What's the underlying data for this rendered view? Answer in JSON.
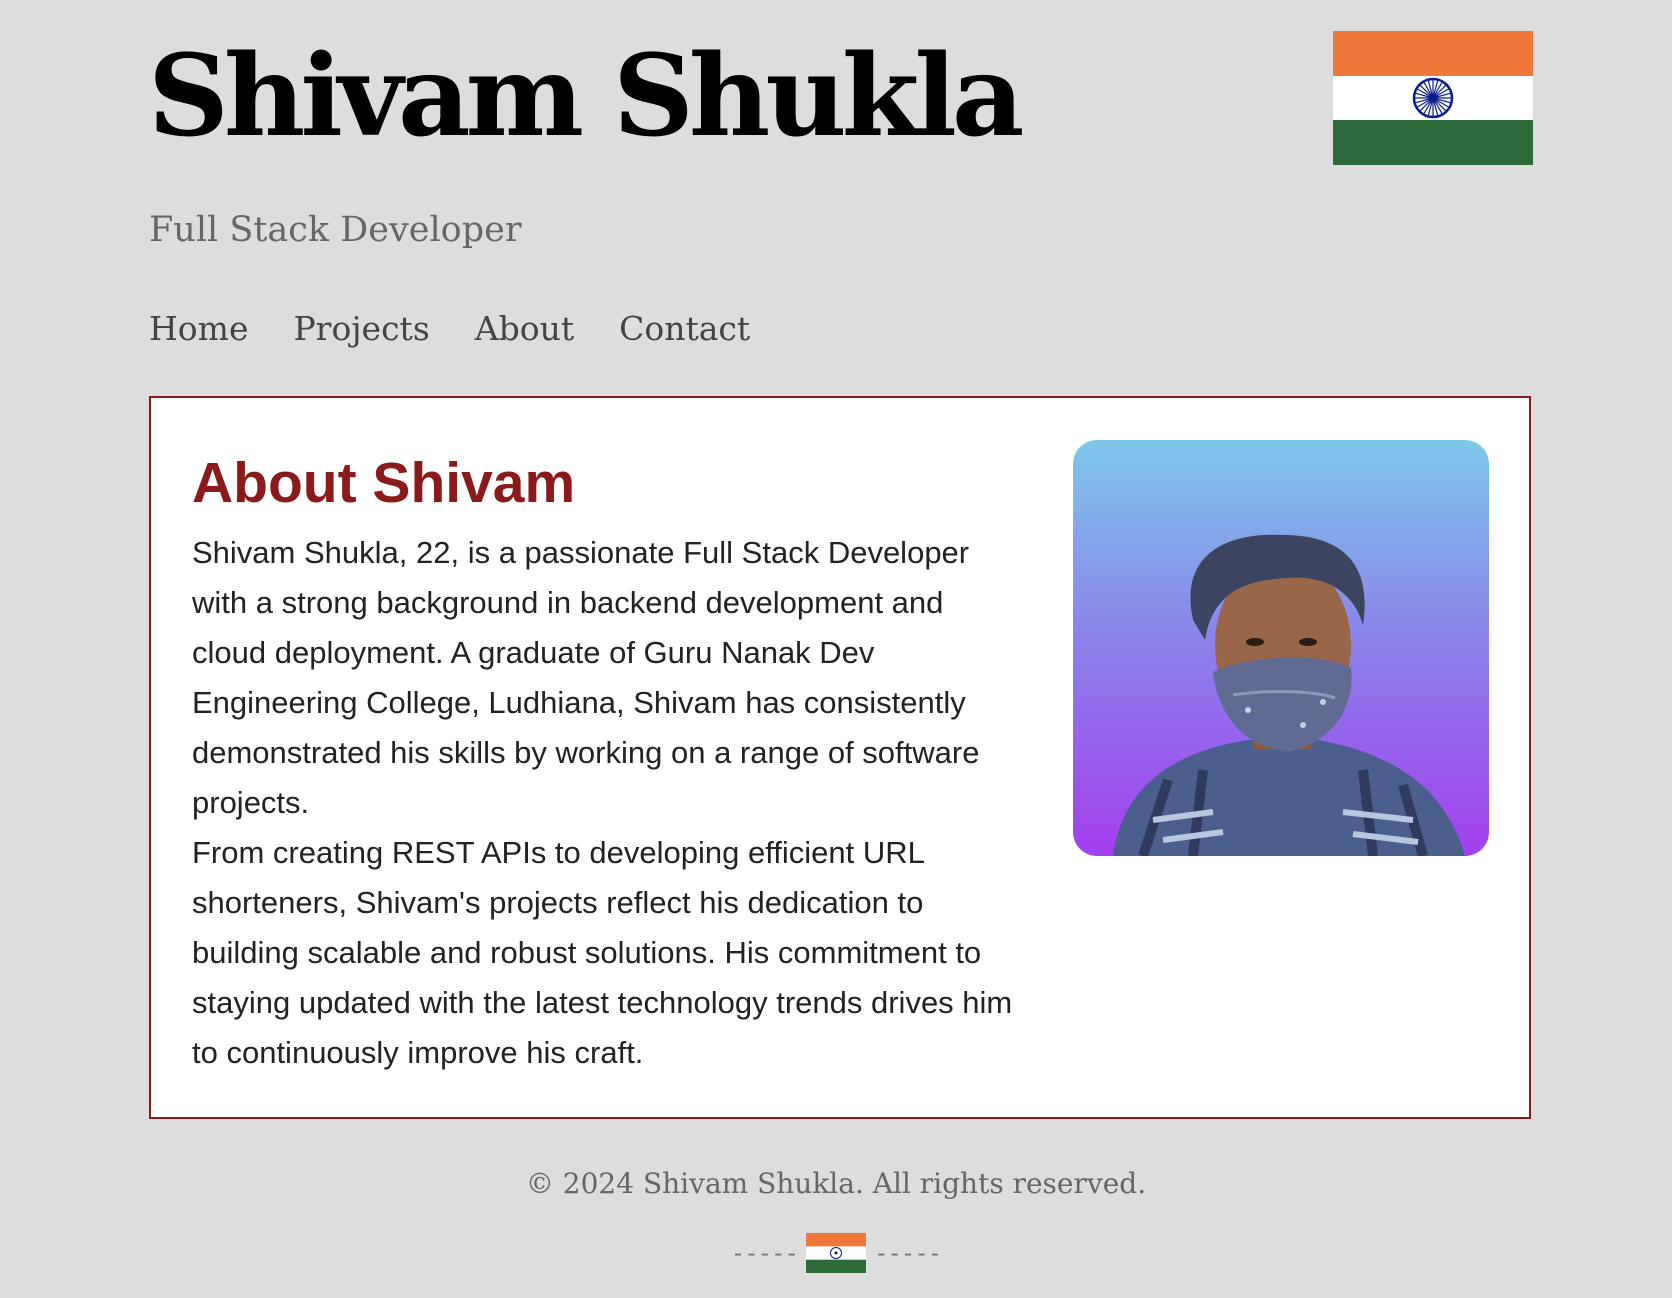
{
  "header": {
    "title": "Shivam Shukla",
    "subtitle": "Full Stack Developer",
    "flag_icon": "india-flag-icon"
  },
  "nav": {
    "items": [
      {
        "label": "Home"
      },
      {
        "label": "Projects"
      },
      {
        "label": "About"
      },
      {
        "label": "Contact"
      }
    ]
  },
  "about": {
    "heading": "About Shivam",
    "paragraphs": [
      "Shivam Shukla, 22, is a passionate Full Stack Developer with a strong background in backend development and cloud deployment. A graduate of Guru Nanak Dev Engineering College, Ludhiana, Shivam has consistently demonstrated his skills by working on a range of software projects.",
      "From creating REST APIs to developing efficient URL shorteners, Shivam's projects reflect his dedication to building scalable and robust solutions. His commitment to staying updated with the latest technology trends drives him to continuously improve his craft."
    ]
  },
  "footer": {
    "copyright": "© 2024 Shivam Shukla. All rights reserved.",
    "divider_left": "-----",
    "divider_right": "-----"
  },
  "colors": {
    "background": "#dddddd",
    "accent": "#8b1a1a",
    "flag_saffron": "#ef773a",
    "flag_green": "#2e6b3a",
    "chakra_blue": "#0a1d8c"
  }
}
